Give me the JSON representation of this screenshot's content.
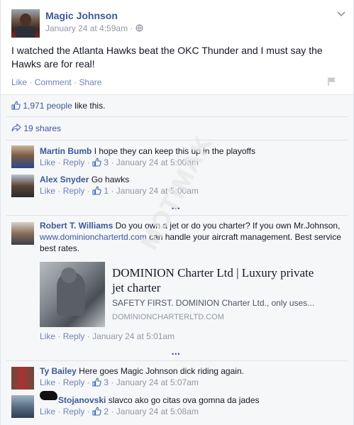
{
  "post": {
    "author": "Magic Johnson",
    "timestamp": "January 24 at 4:59am",
    "separator": "·",
    "text": "I watched the Atlanta Hawks beat the OKC Thunder and I must say the Hawks are for real!",
    "actions": {
      "like": "Like",
      "comment": "Comment",
      "share": "Share",
      "dot": "·"
    },
    "likes_count": "1,971 people",
    "likes_suffix": " like this.",
    "shares": "19 shares"
  },
  "comments": [
    {
      "author": "Martin Bumb",
      "text": "I hope they can keep this up in the playoffs",
      "like": "Like",
      "reply": "Reply",
      "likes": "3",
      "time": "January 24 at 5:00am"
    },
    {
      "author": "Alex Snyder",
      "text": "Go hawks",
      "like": "Like",
      "reply": "Reply",
      "likes": "1",
      "time": "January 24 at 5:00am"
    },
    {
      "author": "Robert T. Williams",
      "text_a": "Do you own a jet or do you charter? If you own Mr.Johnson, ",
      "link": "www.dominionchartertd.com",
      "text_b": " can handle your aircraft management. Best service best rates.",
      "like": "Like",
      "reply": "Reply",
      "time": "January 24 at 5:01am"
    },
    {
      "author": "Ty Bailey",
      "text": "Here goes Magic Johnson dick riding again.",
      "like": "Like",
      "reply": "Reply",
      "likes": "3",
      "time": "January 24 at 5:07am"
    },
    {
      "author": "Stojanovski",
      "text": "slavco ako go citas ova gomna da jades",
      "like": "Like",
      "reply": "Reply",
      "likes": "2",
      "time": "January 24 at 5:08am"
    }
  ],
  "link_preview": {
    "title": "DOMINION Charter Ltd | Luxury private jet charter",
    "description": "SAFETY FIRST. DOMINION Charter Ltd., only uses...",
    "domain": "DOMINIONCHARTERLTD.COM"
  },
  "more_indicator": "•••",
  "watermark": "MOTIMAK",
  "colors": {
    "link": "#3b5998",
    "meta": "#9197a3",
    "band": "#f6f7f9",
    "border": "#e1e2e3"
  }
}
